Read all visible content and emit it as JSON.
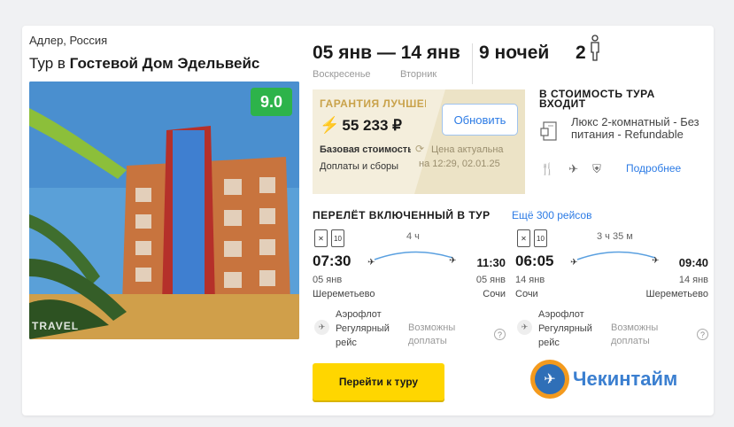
{
  "hotel": {
    "location": "Адлер, Россия",
    "title_prefix": "Тур в ",
    "title_name": "Гостевой Дом Эдельвейс",
    "rating": "9.0",
    "photo_watermark": "TRAVEL"
  },
  "trip": {
    "dates": "05 янв — 14 янв",
    "day_from": "Воскресенье",
    "day_to": "Вторник",
    "nights": "9 ночей",
    "pax": "2"
  },
  "price": {
    "guarantee": "ГАРАНТИЯ ЛУЧШЕЙ",
    "amount": "55 233 ₽",
    "base_cost": "Базовая стоимость",
    "fees": "Доплаты и сборы",
    "refresh_label": "Обновить",
    "actual_line1": "Цена актуальна",
    "actual_line2": "на 12:29, 02.01.25"
  },
  "included": {
    "title": "В СТОИМОСТЬ ТУРА ВХОДИТ",
    "room": "Люкс 2-комнатный - Без питания - Refundable",
    "more_link": "Подробнее"
  },
  "flights": {
    "title": "ПЕРЕЛЁТ ВКЛЮЧЕННЫЙ В ТУР",
    "more_link": "Ещё 300 рейсов",
    "segments": [
      {
        "bag": "10",
        "duration": "4 ч",
        "dep_time": "07:30",
        "arr_time": "11:30",
        "dep_date": "05 янв",
        "arr_date": "05 янв",
        "dep_city": "Шереметьево",
        "arr_city": "Сочи",
        "airline": "Аэрофлот",
        "flight_type": "Регулярный",
        "flight_type2": "рейс",
        "extra1": "Возможны",
        "extra2": "доплаты"
      },
      {
        "bag": "10",
        "duration": "3 ч 35 м",
        "dep_time": "06:05",
        "arr_time": "09:40",
        "dep_date": "14 янв",
        "arr_date": "14 янв",
        "dep_city": "Сочи",
        "arr_city": "Шереметьево",
        "airline": "Аэрофлот",
        "flight_type": "Регулярный",
        "flight_type2": "рейс",
        "extra1": "Возможны",
        "extra2": "доплаты"
      }
    ]
  },
  "actions": {
    "goto_label": "Перейти к туру"
  },
  "brand": {
    "name": "Чекинтайм"
  },
  "colors": {
    "accent": "#2c7be5",
    "rating": "#2db34a",
    "cta": "#ffd600",
    "price_box": "#f4eedc"
  }
}
